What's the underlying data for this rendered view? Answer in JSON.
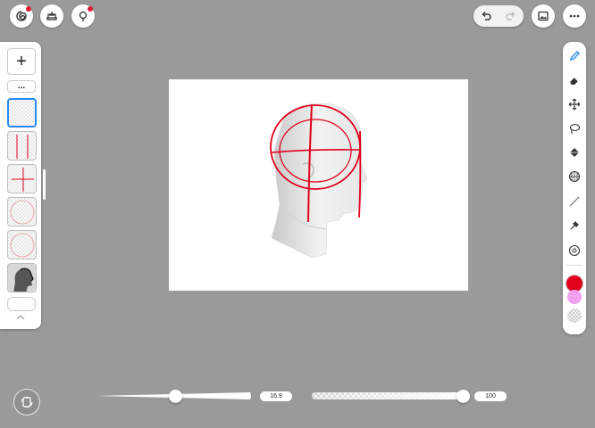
{
  "top_left_buttons": [
    {
      "name": "app-logo-icon",
      "badge": true
    },
    {
      "name": "tray-upload-icon",
      "badge": false
    },
    {
      "name": "lightbulb-icon",
      "badge": true
    }
  ],
  "top_right": {
    "undo_icon": "undo-icon",
    "redo_icon": "redo-icon",
    "gallery_icon": "image-icon",
    "more_icon": "more-horizontal-icon"
  },
  "layers": {
    "add_label": "+",
    "menu_label": "...",
    "thumbnails": [
      {
        "name": "layer-empty",
        "selected": true
      },
      {
        "name": "layer-vertical-lines",
        "selected": false
      },
      {
        "name": "layer-cross-lines",
        "selected": false
      },
      {
        "name": "layer-circle",
        "selected": false
      },
      {
        "name": "layer-circle-2",
        "selected": false
      },
      {
        "name": "layer-head-photo",
        "selected": false
      }
    ],
    "base_layer_label": "",
    "collapse_icon": "chevron-up-icon"
  },
  "tools": [
    "pen-icon",
    "eraser-icon",
    "move-icon",
    "lasso-icon",
    "fill-bucket-icon",
    "grid-icon",
    "line-icon",
    "eyedropper-icon",
    "brush-settings-icon"
  ],
  "colors": {
    "primary": "#e3001b",
    "secondary": "#f2a0f0",
    "accent": "#2a8bf2",
    "stroke": "#e0001a"
  },
  "bottom": {
    "size_value": "16.9",
    "size_fraction": 0.51,
    "opacity_value": "100",
    "opacity_fraction": 1.0,
    "flip_icon": "canvas-flip-icon"
  }
}
